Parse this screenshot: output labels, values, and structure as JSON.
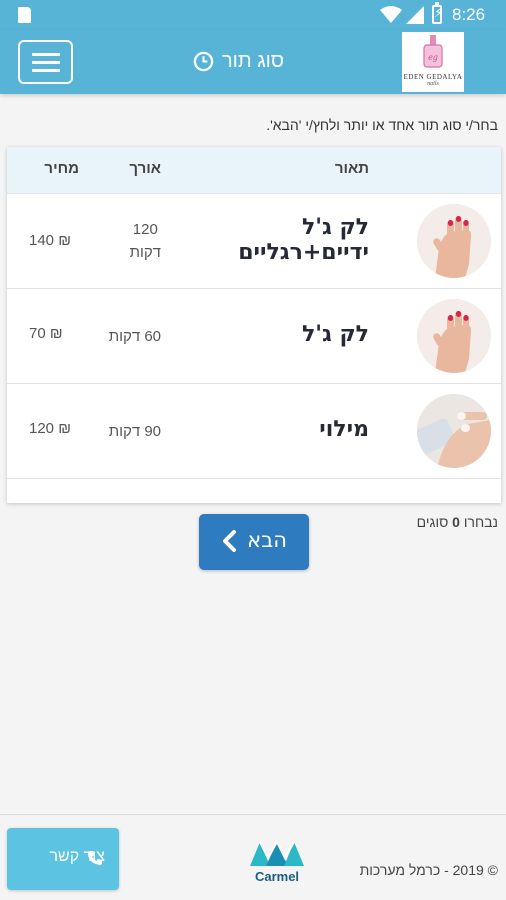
{
  "status_bar": {
    "time": "8:26",
    "icons": [
      "sd-card-icon",
      "wifi-icon",
      "signal-icon",
      "battery-charging-icon"
    ]
  },
  "app_bar": {
    "title": "סוג תור",
    "title_icon": "clock-icon",
    "menu_icon": "hamburger-icon",
    "logo": {
      "brand_text": "EDEN GEDALYA",
      "sub_text": "nails"
    }
  },
  "instruction_text": "בחר/י סוג תור אחד או יותר ולחץ/י 'הבא'.",
  "table": {
    "headers": {
      "description": "תאור",
      "length": "אורך",
      "price": "מחיר"
    },
    "rows": [
      {
        "name_line1": "לק ג'ל",
        "name_line2": "ידיים+רגליים",
        "length_line1": "120",
        "length_line2": "דקות",
        "price": "140 ₪"
      },
      {
        "name_line1": "לק ג'ל",
        "name_line2": "",
        "length_line1": "60 דקות",
        "length_line2": "",
        "price": "70 ₪"
      },
      {
        "name_line1": "מילוי",
        "name_line2": "",
        "length_line1": "90 דקות",
        "length_line2": "",
        "price": "120 ₪"
      }
    ]
  },
  "selection": {
    "prefix": "נבחרו",
    "count": "0",
    "suffix": "סוגים"
  },
  "next_button": {
    "label": "הבא",
    "icon": "chevron-left-icon"
  },
  "footer": {
    "contact_label": "צור קשר",
    "contact_icon": "phone-icon",
    "company_logo_text": "Carmel",
    "copyright": "© 2019 - כרמל מערכות"
  },
  "colors": {
    "app_bar": "#57b4d6",
    "next_button": "#2f7bbf",
    "contact_button": "#5cc4e2",
    "header_row": "#e9f4fa"
  }
}
